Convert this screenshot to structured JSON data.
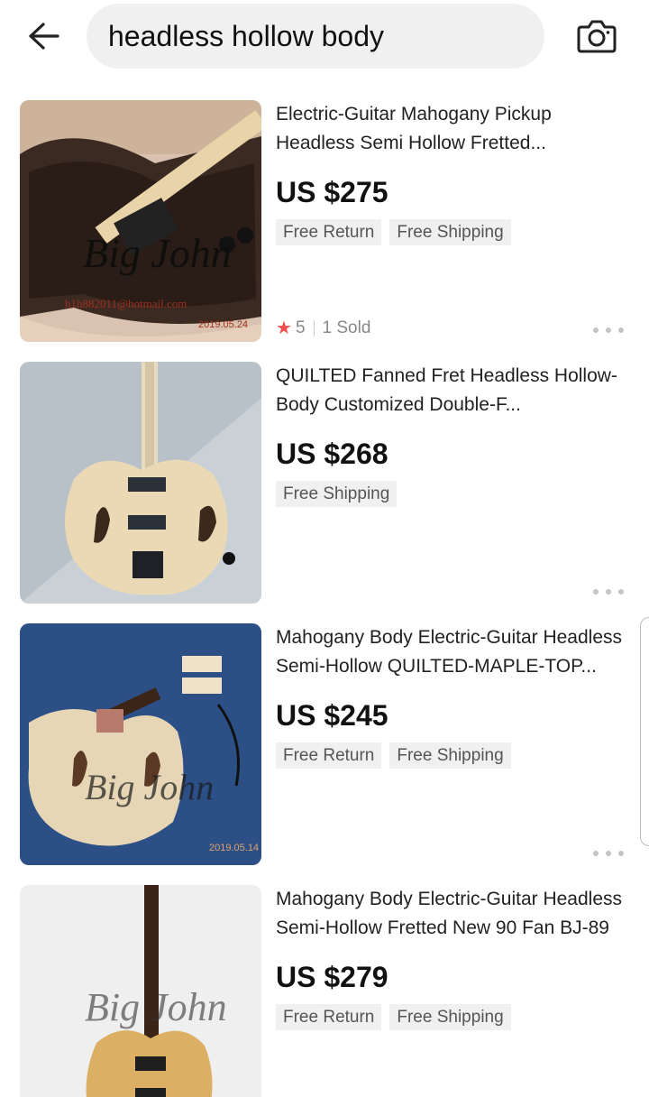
{
  "search": {
    "query": "headless hollow body"
  },
  "icons": {
    "back": "arrow-left-icon",
    "camera": "camera-icon",
    "more": "more-dots-icon",
    "star": "star-icon"
  },
  "colors": {
    "star": "#f04c4c",
    "tag_bg": "#f0f0f0",
    "search_bg": "#f0f0f0"
  },
  "products": [
    {
      "title": "Electric-Guitar Mahogany Pickup Headless Semi Hollow Fretted...",
      "price": "US $275",
      "tags": [
        "Free Return",
        "Free Shipping"
      ],
      "rating": "5",
      "sold": "1 Sold",
      "image_text": [
        "Big John",
        "h1h882011@hotmail.com",
        "2019.05.24"
      ]
    },
    {
      "title": "QUILTED Fanned Fret Headless Hollow-Body Customized Double-F...",
      "price": "US $268",
      "tags": [
        "Free Shipping"
      ]
    },
    {
      "title": "Mahogany Body Electric-Guitar Headless Semi-Hollow QUILTED-MAPLE-TOP...",
      "price": "US $245",
      "tags": [
        "Free Return",
        "Free Shipping"
      ],
      "image_text": [
        "Big John",
        "2019.05.14"
      ]
    },
    {
      "title": "Mahogany Body Electric-Guitar Headless Semi-Hollow Fretted New 90 Fan BJ-89",
      "price": "US $279",
      "tags": [
        "Free Return",
        "Free Shipping"
      ],
      "image_text": [
        "Big John"
      ]
    }
  ]
}
